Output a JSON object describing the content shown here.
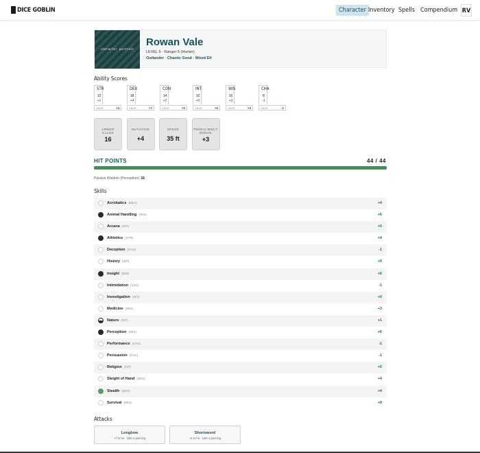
{
  "app": {
    "logo": "DICE GOBLIN",
    "nav": [
      "Character",
      "Inventory",
      "Spells",
      "Compendium"
    ],
    "active_nav": "Character",
    "user_initials": "RV"
  },
  "character": {
    "portrait_label": "character portrait",
    "name": "Rowan Vale",
    "subtitle": "LEVEL 5 · Ranger 5 (Hunter)",
    "background_line": "Outlander · Chaotic Good · Wood Elf"
  },
  "abilities_title": "Ability Scores",
  "abilities": [
    {
      "abbr": "STR",
      "score": "12",
      "mod": "+1",
      "save_label": "SAVE",
      "save": "+4"
    },
    {
      "abbr": "DEX",
      "score": "18",
      "mod": "+4",
      "save_label": "SAVE",
      "save": "+7"
    },
    {
      "abbr": "CON",
      "score": "14",
      "mod": "+2",
      "save_label": "SAVE",
      "save": "+2"
    },
    {
      "abbr": "INT",
      "score": "10",
      "mod": "+0",
      "save_label": "SAVE",
      "save": "+0"
    },
    {
      "abbr": "WIS",
      "score": "16",
      "mod": "+3",
      "save_label": "SAVE",
      "save": "+3"
    },
    {
      "abbr": "CHA",
      "score": "8",
      "mod": "-1",
      "save_label": "SAVE",
      "save": "-1"
    }
  ],
  "stats": [
    {
      "label": "ARMOR CLASS",
      "value": "16"
    },
    {
      "label": "INITIATIVE",
      "value": "+4"
    },
    {
      "label": "SPEED",
      "value": "35 ft"
    },
    {
      "label": "PROFICIENCY BONUS",
      "value": "+3"
    }
  ],
  "hp": {
    "title": "HIT POINTS",
    "value": "44 / 44",
    "current": 44,
    "max": 44
  },
  "passive": {
    "label": "Passive Wisdom (Perception):",
    "value": "16"
  },
  "skills_title": "Skills",
  "skills": [
    {
      "name": "Acrobatics",
      "attr": "(DEX)",
      "bonus": "+4",
      "prof": "none"
    },
    {
      "name": "Animal Handling",
      "attr": "(WIS)",
      "bonus": "+6",
      "prof": "proficient"
    },
    {
      "name": "Arcana",
      "attr": "(INT)",
      "bonus": "+0",
      "prof": "none"
    },
    {
      "name": "Athletics",
      "attr": "(STR)",
      "bonus": "+4",
      "prof": "proficient"
    },
    {
      "name": "Deception",
      "attr": "(CHA)",
      "bonus": "-1",
      "prof": "none"
    },
    {
      "name": "History",
      "attr": "(INT)",
      "bonus": "+0",
      "prof": "none"
    },
    {
      "name": "Insight",
      "attr": "(WIS)",
      "bonus": "+6",
      "prof": "proficient"
    },
    {
      "name": "Intimidation",
      "attr": "(CHA)",
      "bonus": "-1",
      "prof": "none"
    },
    {
      "name": "Investigation",
      "attr": "(INT)",
      "bonus": "+0",
      "prof": "none"
    },
    {
      "name": "Medicine",
      "attr": "(WIS)",
      "bonus": "+3",
      "prof": "none"
    },
    {
      "name": "Nature",
      "attr": "(INT)",
      "bonus": "+1",
      "prof": "half"
    },
    {
      "name": "Perception",
      "attr": "(WIS)",
      "bonus": "+6",
      "prof": "proficient"
    },
    {
      "name": "Performance",
      "attr": "(CHA)",
      "bonus": "-1",
      "prof": "none"
    },
    {
      "name": "Persuasion",
      "attr": "(CHA)",
      "bonus": "-1",
      "prof": "none"
    },
    {
      "name": "Religion",
      "attr": "(INT)",
      "bonus": "+0",
      "prof": "none"
    },
    {
      "name": "Sleight of Hand",
      "attr": "(DEX)",
      "bonus": "+4",
      "prof": "none"
    },
    {
      "name": "Stealth",
      "attr": "(DEX)",
      "bonus": "+4",
      "prof": "expertise"
    },
    {
      "name": "Survival",
      "attr": "(WIS)",
      "bonus": "+9",
      "prof": "none"
    }
  ],
  "attacks_title": "Attacks",
  "attacks": [
    {
      "name": "Longbow",
      "detail": "+7 to hit · 1d8+4 piercing"
    },
    {
      "name": "Shortsword",
      "detail": "+4 to hit · 1d6+1 piercing"
    }
  ],
  "colors": {
    "accent": "#16505f",
    "hp_fill": "#4c8a5a",
    "expertise": "#5c9a6b"
  }
}
